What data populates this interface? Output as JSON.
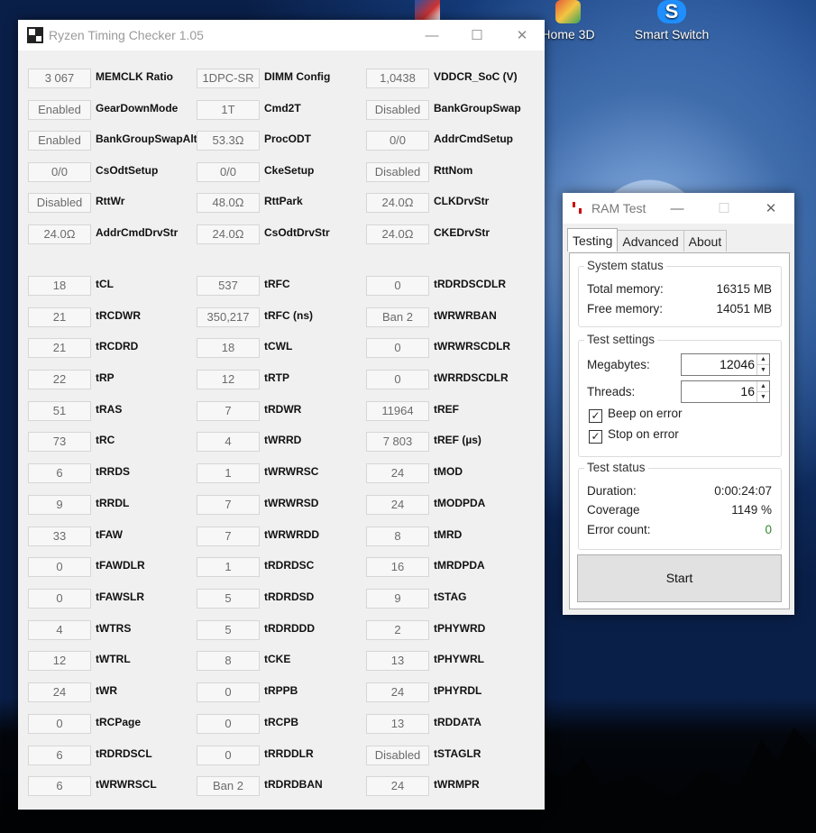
{
  "desktop": {
    "icons": [
      {
        "label": "Home 3D"
      },
      {
        "label": "Smart Switch",
        "glyph": "S"
      }
    ]
  },
  "ryzen": {
    "title": "Ryzen Timing Checker 1.05",
    "controls": {
      "minimize": "—",
      "maximize": "☐",
      "close": "✕"
    },
    "rows": [
      [
        [
          "3 067",
          "MEMCLK Ratio"
        ],
        [
          "1DPC-SR",
          "DIMM Config"
        ],
        [
          "1,0438",
          "VDDCR_SoC (V)"
        ]
      ],
      [
        [
          "Enabled",
          "GearDownMode"
        ],
        [
          "1T",
          "Cmd2T"
        ],
        [
          "Disabled",
          "BankGroupSwap"
        ]
      ],
      [
        [
          "Enabled",
          "BankGroupSwapAlt"
        ],
        [
          "53.3Ω",
          "ProcODT"
        ],
        [
          "0/0",
          "AddrCmdSetup"
        ]
      ],
      [
        [
          "0/0",
          "CsOdtSetup"
        ],
        [
          "0/0",
          "CkeSetup"
        ],
        [
          "Disabled",
          "RttNom"
        ]
      ],
      [
        [
          "Disabled",
          "RttWr"
        ],
        [
          "48.0Ω",
          "RttPark"
        ],
        [
          "24.0Ω",
          "CLKDrvStr"
        ]
      ],
      [
        [
          "24.0Ω",
          "AddrCmdDrvStr"
        ],
        [
          "24.0Ω",
          "CsOdtDrvStr"
        ],
        [
          "24.0Ω",
          "CKEDrvStr"
        ]
      ],
      null,
      [
        [
          "18",
          "tCL"
        ],
        [
          "537",
          "tRFC"
        ],
        [
          "0",
          "tRDRDSCDLR"
        ]
      ],
      [
        [
          "21",
          "tRCDWR"
        ],
        [
          "350,217",
          "tRFC (ns)"
        ],
        [
          "Ban 2",
          "tWRWRBAN"
        ]
      ],
      [
        [
          "21",
          "tRCDRD"
        ],
        [
          "18",
          "tCWL"
        ],
        [
          "0",
          "tWRWRSCDLR"
        ]
      ],
      [
        [
          "22",
          "tRP"
        ],
        [
          "12",
          "tRTP"
        ],
        [
          "0",
          "tWRRDSCDLR"
        ]
      ],
      [
        [
          "51",
          "tRAS"
        ],
        [
          "7",
          "tRDWR"
        ],
        [
          "11964",
          "tREF"
        ]
      ],
      [
        [
          "73",
          "tRC"
        ],
        [
          "4",
          "tWRRD"
        ],
        [
          "7 803",
          "tREF (µs)"
        ]
      ],
      [
        [
          "6",
          "tRRDS"
        ],
        [
          "1",
          "tWRWRSC"
        ],
        [
          "24",
          "tMOD"
        ]
      ],
      [
        [
          "9",
          "tRRDL"
        ],
        [
          "7",
          "tWRWRSD"
        ],
        [
          "24",
          "tMODPDA"
        ]
      ],
      [
        [
          "33",
          "tFAW"
        ],
        [
          "7",
          "tWRWRDD"
        ],
        [
          "8",
          "tMRD"
        ]
      ],
      [
        [
          "0",
          "tFAWDLR"
        ],
        [
          "1",
          "tRDRDSC"
        ],
        [
          "16",
          "tMRDPDA"
        ]
      ],
      [
        [
          "0",
          "tFAWSLR"
        ],
        [
          "5",
          "tRDRDSD"
        ],
        [
          "9",
          "tSTAG"
        ]
      ],
      [
        [
          "4",
          "tWTRS"
        ],
        [
          "5",
          "tRDRDDD"
        ],
        [
          "2",
          "tPHYWRD"
        ]
      ],
      [
        [
          "12",
          "tWTRL"
        ],
        [
          "8",
          "tCKE"
        ],
        [
          "13",
          "tPHYWRL"
        ]
      ],
      [
        [
          "24",
          "tWR"
        ],
        [
          "0",
          "tRPPB"
        ],
        [
          "24",
          "tPHYRDL"
        ]
      ],
      [
        [
          "0",
          "tRCPage"
        ],
        [
          "0",
          "tRCPB"
        ],
        [
          "13",
          "tRDDATA"
        ]
      ],
      [
        [
          "6",
          "tRDRDSCL"
        ],
        [
          "0",
          "tRRDDLR"
        ],
        [
          "Disabled",
          "tSTAGLR"
        ]
      ],
      [
        [
          "6",
          "tWRWRSCL"
        ],
        [
          "Ban 2",
          "tRDRDBAN"
        ],
        [
          "24",
          "tWRMPR"
        ]
      ]
    ]
  },
  "ramtest": {
    "title": "RAM Test",
    "controls": {
      "minimize": "—",
      "maximize": "☐",
      "close": "✕"
    },
    "tabs": [
      "Testing",
      "Advanced",
      "About"
    ],
    "system_status": {
      "title": "System status",
      "total_label": "Total memory:",
      "total_value": "16315 MB",
      "free_label": "Free memory:",
      "free_value": "14051 MB"
    },
    "test_settings": {
      "title": "Test settings",
      "megabytes_label": "Megabytes:",
      "megabytes_value": "12046",
      "threads_label": "Threads:",
      "threads_value": "16",
      "beep_label": "Beep on error",
      "beep_checked": true,
      "stop_label": "Stop on error",
      "stop_checked": true
    },
    "test_status": {
      "title": "Test status",
      "duration_label": "Duration:",
      "duration_value": "0:00:24:07",
      "coverage_label": "Coverage",
      "coverage_value": "1149 %",
      "errors_label": "Error count:",
      "errors_value": "0",
      "error_color": "#2e8b2e"
    },
    "start_label": "Start"
  }
}
